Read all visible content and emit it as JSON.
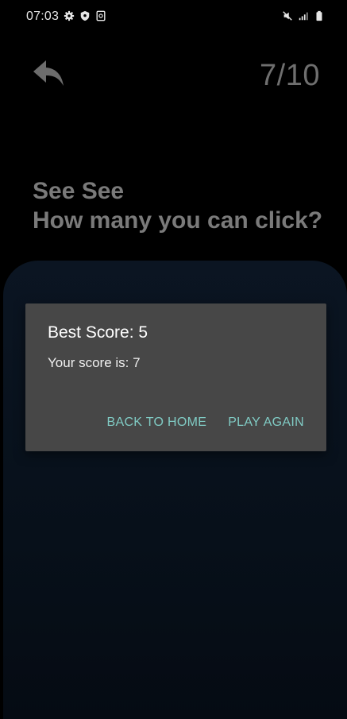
{
  "status_bar": {
    "time": "07:03",
    "left_icons": [
      "gear-icon",
      "shield-icon",
      "screenshot-icon"
    ],
    "right_icons": [
      "mute-icon",
      "signal-icon",
      "battery-icon"
    ]
  },
  "header": {
    "back_icon": "reply-arrow-icon",
    "progress": "7/10"
  },
  "title": {
    "line1": "See See",
    "line2": "How many you can click?"
  },
  "dialog": {
    "title": "Best Score: 5",
    "message": "Your score is: 7",
    "back_label": "BACK TO HOME",
    "play_label": "PLAY AGAIN",
    "accent_color": "#80cbc4"
  }
}
